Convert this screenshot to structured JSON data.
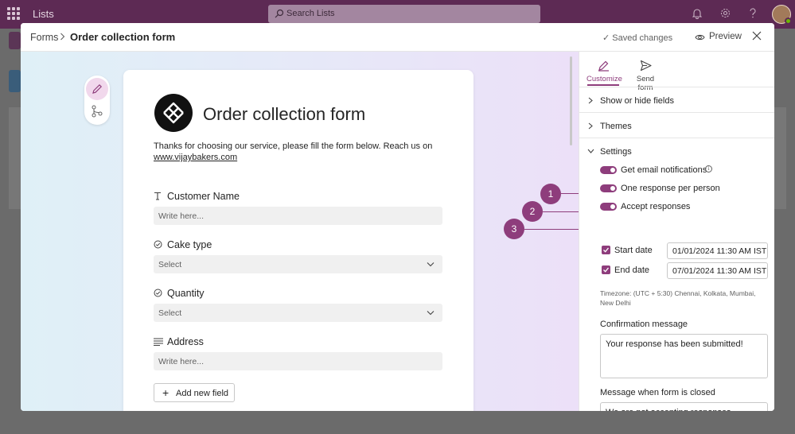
{
  "appbar": {
    "app_name": "Lists",
    "search_placeholder": "Search Lists"
  },
  "modal": {
    "breadcrumb": {
      "parent": "Forms",
      "current": "Order collection form"
    },
    "saved_status": "✓ Saved changes",
    "preview_label": "Preview"
  },
  "form": {
    "title": "Order collection form",
    "description": "Thanks for choosing our service, please fill the form below. Reach us on",
    "link": "www.vijaybakers.com",
    "questions": [
      {
        "label": "Customer Name",
        "type": "text",
        "placeholder": "Write here..."
      },
      {
        "label": "Cake type",
        "type": "choice",
        "placeholder": "Select"
      },
      {
        "label": "Quantity",
        "type": "choice",
        "placeholder": "Select"
      },
      {
        "label": "Address",
        "type": "multiline",
        "placeholder": "Write here..."
      }
    ],
    "add_field_label": "Add new field"
  },
  "callouts": [
    "1",
    "2",
    "3"
  ],
  "panel": {
    "tabs": [
      {
        "label": "Customize",
        "icon": "customize-icon",
        "active": true
      },
      {
        "label": "Send form",
        "icon": "send-icon",
        "active": false
      }
    ],
    "sections": {
      "show_hide": "Show or hide fields",
      "themes": "Themes",
      "settings": "Settings"
    },
    "toggles": [
      {
        "label": "Get email notifications",
        "on": true
      },
      {
        "label": "One response per person",
        "on": true
      },
      {
        "label": "Accept responses",
        "on": true
      }
    ],
    "start_date": {
      "label": "Start date",
      "value": "01/01/2024 11:30 AM IST",
      "checked": true
    },
    "end_date": {
      "label": "End date",
      "value": "07/01/2024 11:30 AM IST",
      "checked": true
    },
    "timezone": "Timezone: (UTC + 5:30) Chennai, Kolkata, Mumbai, New Delhi",
    "confirmation": {
      "label": "Confirmation message",
      "value": "Your response has been submitted!"
    },
    "closed": {
      "label": "Message when form is closed",
      "value": "We are not accepting responses"
    }
  },
  "colors": {
    "accent": "#8e3d7c",
    "appbar": "#5d2a54"
  }
}
